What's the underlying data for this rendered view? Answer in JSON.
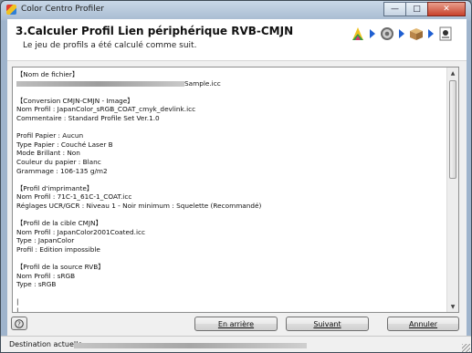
{
  "window": {
    "title": "Color Centro Profiler"
  },
  "header": {
    "step_number": "3.",
    "step_title": "Calculer Profil Lien périphérique RVB-CMJN",
    "subtitle": "Le jeu de profils a été calculé comme suit."
  },
  "steps_icons": [
    "gamut-icon",
    "gear-icon",
    "box-icon",
    "printer-profile-icon"
  ],
  "content": {
    "lines": [
      "【Nom de fichier】",
      "",
      "",
      "【Conversion CMJN-CMJN - Image】",
      "Nom Profil : JapanColor_sRGB_COAT_cmyk_devlink.icc",
      "Commentaire : Standard Profile Set Ver.1.0",
      "",
      "Profil Papier : Aucun",
      "Type Papier : Couché Laser B",
      "Mode Brillant : Non",
      "Couleur du papier : Blanc",
      "Grammage : 106-135 g/m2",
      "",
      "【Profil d'imprimante】",
      "Nom Profil : 71C-1_61C-1_COAT.icc",
      "Réglages UCR/GCR : Niveau 1 - Noir minimum : Squelette (Recommandé)",
      "",
      "【Profil de la cible CMJN】",
      "Nom Profil : JapanColor2001Coated.icc",
      "Type : JapanColor",
      "Profil : Edition impossible",
      "",
      "【Profil de la source RVB】",
      "Nom Profil : sRGB",
      "Type : sRGB",
      "",
      "|",
      "|"
    ],
    "file_suffix": "Sample.icc"
  },
  "buttons": {
    "help": "?",
    "back": "En arrière",
    "next": "Suivant",
    "cancel": "Annuler"
  },
  "status": {
    "label": "Destination actuelle"
  },
  "colors": {
    "accent_arrow": "#1f5fd1"
  }
}
